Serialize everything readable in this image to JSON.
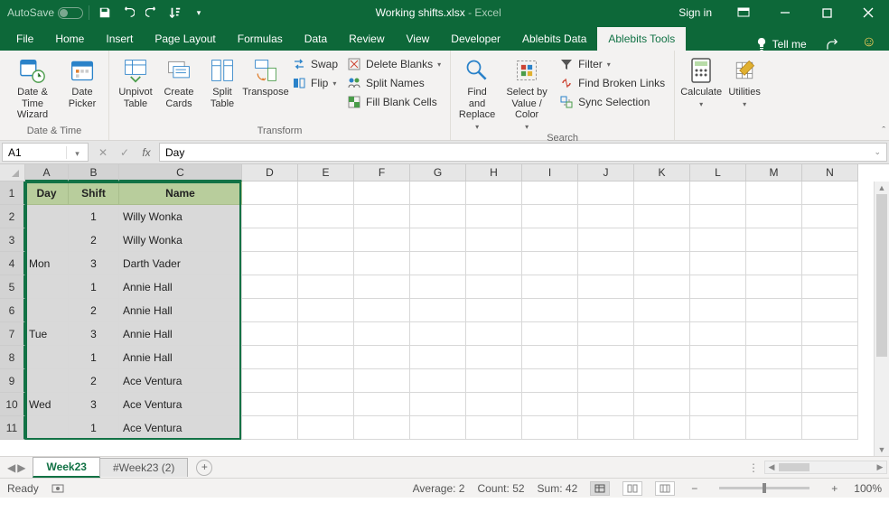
{
  "titlebar": {
    "autosave": "AutoSave",
    "autosave_state": "Off",
    "filename": "Working shifts.xlsx",
    "app": "Excel",
    "signin": "Sign in"
  },
  "tabs": {
    "file": "File",
    "items": [
      "Home",
      "Insert",
      "Page Layout",
      "Formulas",
      "Data",
      "Review",
      "View",
      "Developer",
      "Ablebits Data",
      "Ablebits Tools"
    ],
    "active_index": 9,
    "tellme": "Tell me"
  },
  "ribbon": {
    "groups": {
      "datetime": {
        "label": "Date & Time",
        "date_time_wizard": "Date & Time Wizard",
        "date_picker": "Date Picker"
      },
      "transform": {
        "label": "Transform",
        "unpivot": "Unpivot Table",
        "create_cards": "Create Cards",
        "split_table": "Split Table",
        "transpose": "Transpose",
        "swap": "Swap",
        "flip": "Flip",
        "delete_blanks": "Delete Blanks",
        "split_names": "Split Names",
        "fill_blank": "Fill Blank Cells"
      },
      "search": {
        "label": "Search",
        "find_replace": "Find and Replace",
        "select_vc": "Select by Value / Color",
        "filter": "Filter",
        "broken_links": "Find Broken Links",
        "sync_sel": "Sync Selection"
      },
      "calc": {
        "calculate": "Calculate",
        "utilities": "Utilities"
      }
    }
  },
  "formula_bar": {
    "namebox": "A1",
    "formula": "Day"
  },
  "grid": {
    "columns": [
      "A",
      "B",
      "C",
      "D",
      "E",
      "F",
      "G",
      "H",
      "I",
      "J",
      "K",
      "L",
      "M",
      "N"
    ],
    "col_widths": {
      "A": 48,
      "B": 56,
      "C": 136
    },
    "headers": {
      "A": "Day",
      "B": "Shift",
      "C": "Name"
    },
    "rows": [
      {
        "n": 2,
        "A": "",
        "B": "1",
        "C": "Willy Wonka"
      },
      {
        "n": 3,
        "A": "",
        "B": "2",
        "C": "Willy Wonka"
      },
      {
        "n": 4,
        "A": "Mon",
        "B": "3",
        "C": "Darth Vader"
      },
      {
        "n": 5,
        "A": "",
        "B": "1",
        "C": "Annie Hall"
      },
      {
        "n": 6,
        "A": "",
        "B": "2",
        "C": "Annie Hall"
      },
      {
        "n": 7,
        "A": "Tue",
        "B": "3",
        "C": "Annie Hall"
      },
      {
        "n": 8,
        "A": "",
        "B": "1",
        "C": "Annie Hall"
      },
      {
        "n": 9,
        "A": "",
        "B": "2",
        "C": "Ace Ventura"
      },
      {
        "n": 10,
        "A": "Wed",
        "B": "3",
        "C": "Ace Ventura"
      },
      {
        "n": 11,
        "A": "",
        "B": "1",
        "C": "Ace Ventura"
      }
    ],
    "selected_cols": [
      "A",
      "B",
      "C"
    ],
    "visible_rows": 11
  },
  "sheets": {
    "tabs": [
      "Week23",
      "#Week23 (2)"
    ],
    "active_index": 0
  },
  "status": {
    "mode": "Ready",
    "average_label": "Average:",
    "average_value": "2",
    "count_label": "Count:",
    "count_value": "52",
    "sum_label": "Sum:",
    "sum_value": "42",
    "zoom": "100%"
  }
}
